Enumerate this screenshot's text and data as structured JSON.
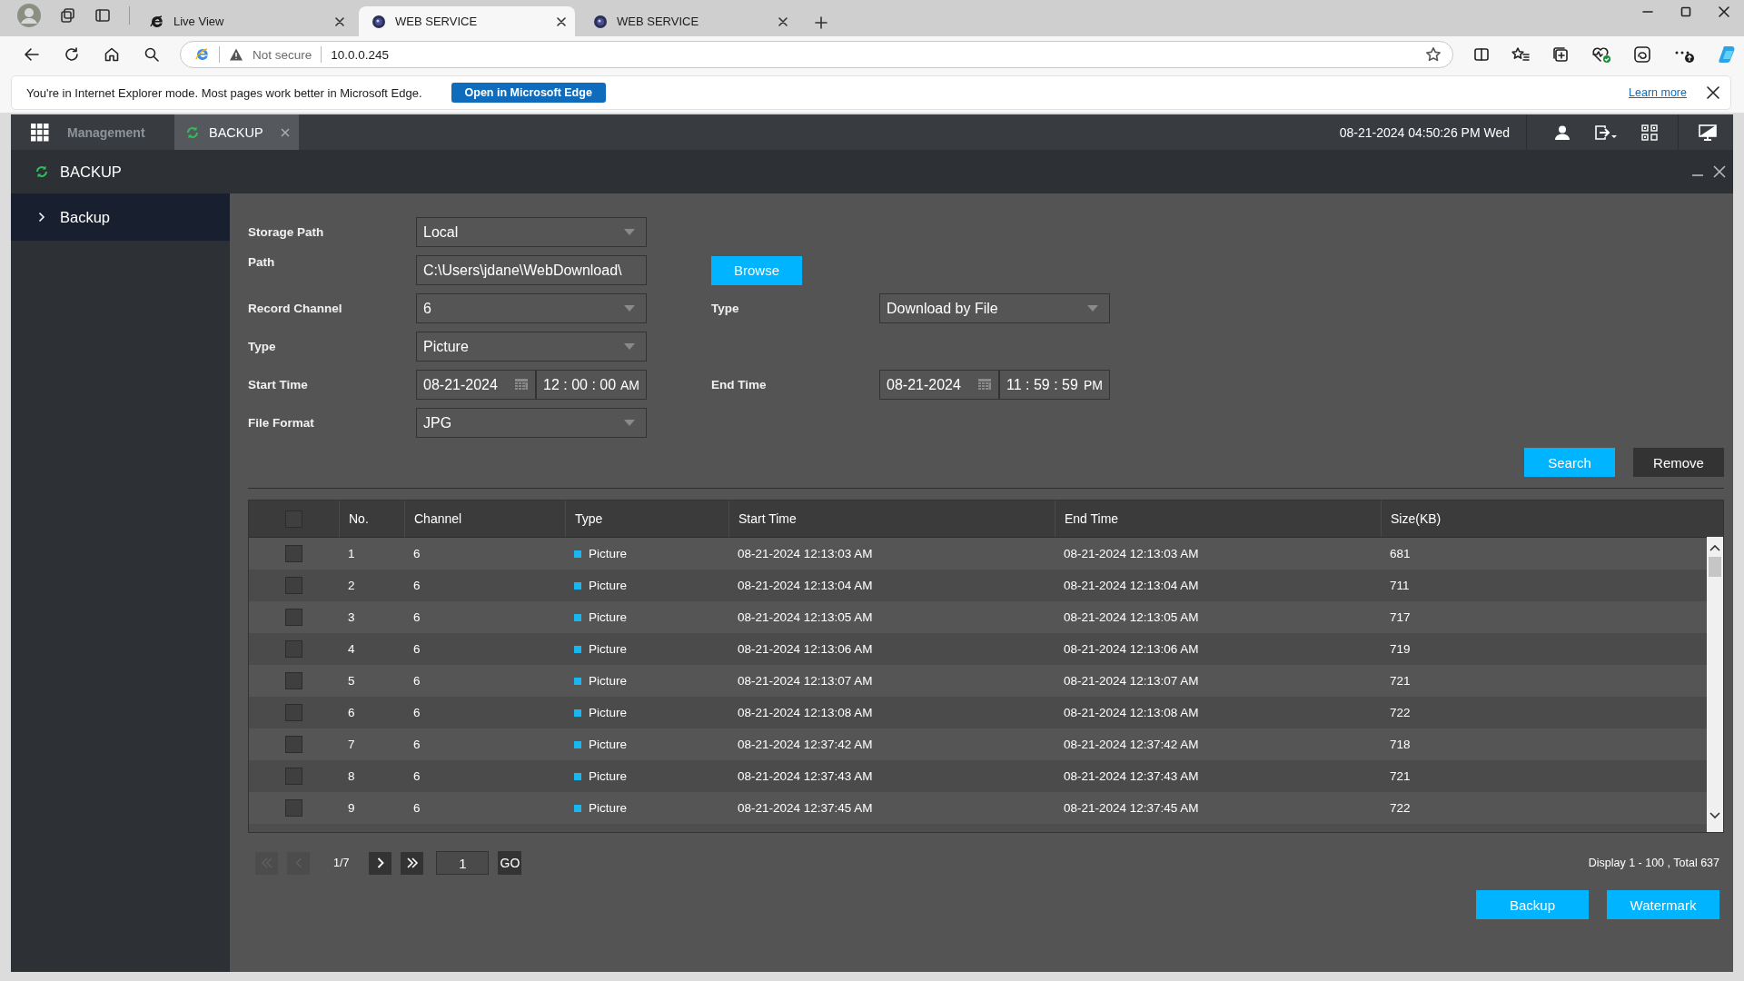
{
  "browser": {
    "tabs": [
      {
        "title": "Live View",
        "kind": "ie",
        "selected": false
      },
      {
        "title": "WEB SERVICE",
        "kind": "site",
        "selected": true
      },
      {
        "title": "WEB SERVICE",
        "kind": "site",
        "selected": false
      }
    ],
    "security": "Not secure",
    "url": "10.0.0.245",
    "infobar": {
      "message": "You're in Internet Explorer mode. Most pages work better in Microsoft Edge.",
      "button": "Open in Microsoft Edge",
      "link": "Learn more"
    }
  },
  "app": {
    "menu_label": "Management",
    "tabs": [
      {
        "label": "BACKUP",
        "selected": true
      }
    ],
    "datetime": "08-21-2024 04:50:26 PM Wed"
  },
  "panel": {
    "title": "BACKUP",
    "sidebar": [
      {
        "label": "Backup",
        "selected": true
      }
    ]
  },
  "form": {
    "rows": [
      [
        {
          "kind": "dropdown",
          "label": "Storage Path",
          "value": "Local"
        }
      ],
      [
        {
          "kind": "text",
          "label": "Path",
          "value": "C:\\Users\\jdane\\WebDownload\\"
        },
        {
          "kind": "button",
          "label": "Browse"
        }
      ],
      [
        {
          "kind": "dropdown",
          "label": "Record Channel",
          "value": "6"
        },
        {
          "kind": "dropdown",
          "label": "Type",
          "value": "Download by File"
        }
      ],
      [
        {
          "kind": "dropdown",
          "label": "Type",
          "value": "Picture"
        }
      ],
      [
        {
          "kind": "datetime",
          "label": "Start Time",
          "date": "08-21-2024",
          "time": "12 : 00 : 00",
          "meridiem": "AM"
        },
        {
          "kind": "datetime",
          "label": "End Time",
          "date": "08-21-2024",
          "time": "11 : 59 : 59",
          "meridiem": "PM"
        }
      ],
      [
        {
          "kind": "dropdown",
          "label": "File Format",
          "value": "JPG"
        }
      ]
    ],
    "actions": [
      {
        "label": "Search",
        "kind": "primary"
      },
      {
        "label": "Remove",
        "kind": "secondary"
      }
    ]
  },
  "table": {
    "select_all": false,
    "columns": [
      "No.",
      "Channel",
      "Type",
      "Start Time",
      "End Time",
      "Size(KB)"
    ],
    "rows": [
      {
        "checked": false,
        "no": "1",
        "channel": "6",
        "type": "Picture",
        "start": "08-21-2024 12:13:03 AM",
        "end": "08-21-2024 12:13:03 AM",
        "size": "681"
      },
      {
        "checked": false,
        "no": "2",
        "channel": "6",
        "type": "Picture",
        "start": "08-21-2024 12:13:04 AM",
        "end": "08-21-2024 12:13:04 AM",
        "size": "711"
      },
      {
        "checked": false,
        "no": "3",
        "channel": "6",
        "type": "Picture",
        "start": "08-21-2024 12:13:05 AM",
        "end": "08-21-2024 12:13:05 AM",
        "size": "717"
      },
      {
        "checked": false,
        "no": "4",
        "channel": "6",
        "type": "Picture",
        "start": "08-21-2024 12:13:06 AM",
        "end": "08-21-2024 12:13:06 AM",
        "size": "719"
      },
      {
        "checked": false,
        "no": "5",
        "channel": "6",
        "type": "Picture",
        "start": "08-21-2024 12:13:07 AM",
        "end": "08-21-2024 12:13:07 AM",
        "size": "721"
      },
      {
        "checked": false,
        "no": "6",
        "channel": "6",
        "type": "Picture",
        "start": "08-21-2024 12:13:08 AM",
        "end": "08-21-2024 12:13:08 AM",
        "size": "722"
      },
      {
        "checked": false,
        "no": "7",
        "channel": "6",
        "type": "Picture",
        "start": "08-21-2024 12:37:42 AM",
        "end": "08-21-2024 12:37:42 AM",
        "size": "718"
      },
      {
        "checked": false,
        "no": "8",
        "channel": "6",
        "type": "Picture",
        "start": "08-21-2024 12:37:43 AM",
        "end": "08-21-2024 12:37:43 AM",
        "size": "721"
      },
      {
        "checked": false,
        "no": "9",
        "channel": "6",
        "type": "Picture",
        "start": "08-21-2024 12:37:45 AM",
        "end": "08-21-2024 12:37:45 AM",
        "size": "722"
      }
    ]
  },
  "pager": {
    "buttons": [
      {
        "kind": "first",
        "disabled": true
      },
      {
        "kind": "prev",
        "disabled": true
      }
    ],
    "page_label": "1/7",
    "nav": [
      {
        "kind": "next",
        "disabled": false
      },
      {
        "kind": "last",
        "disabled": false
      }
    ],
    "page_input": "1",
    "go": "GO",
    "summary": "Display 1 - 100 , Total 637"
  },
  "footer": [
    {
      "label": "Backup"
    },
    {
      "label": "Watermark"
    }
  ]
}
